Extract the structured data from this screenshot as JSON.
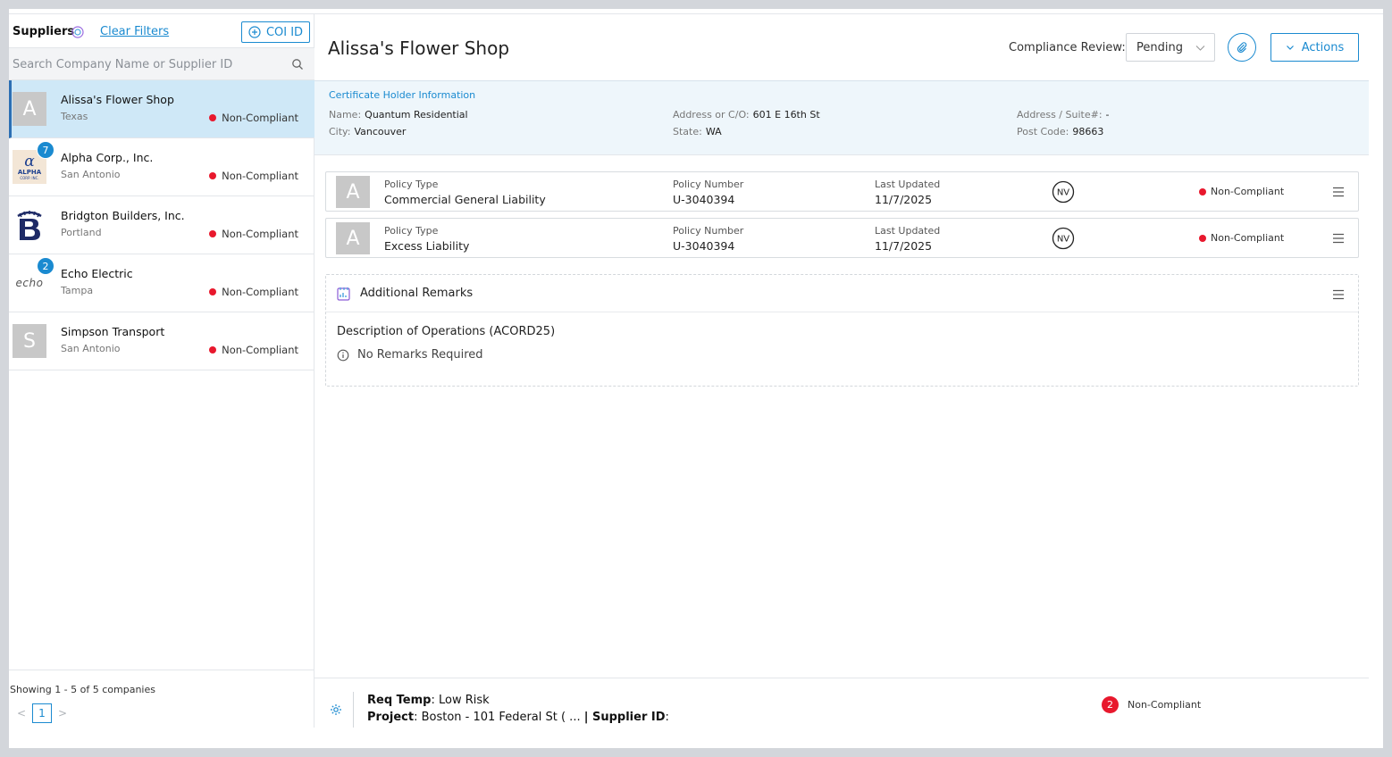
{
  "sidebar": {
    "title": "Suppliers",
    "clear_filters": "Clear Filters",
    "coi_button": "COI ID",
    "search_placeholder": "Search Company Name or Supplier ID",
    "items": [
      {
        "name": "Alissa's Flower Shop",
        "location": "Texas",
        "status": "Non-Compliant",
        "avatar": "A",
        "badge": ""
      },
      {
        "name": "Alpha Corp., Inc.",
        "location": "San Antonio",
        "status": "Non-Compliant",
        "avatar": "logo-alpha",
        "badge": "7",
        "logo_text": "ALPHA",
        "logo_sub": "CORP. INC."
      },
      {
        "name": "Bridgton Builders, Inc.",
        "location": "Portland",
        "status": "Non-Compliant",
        "avatar": "logo-bridgton",
        "badge": ""
      },
      {
        "name": "Echo Electric",
        "location": "Tampa",
        "status": "Non-Compliant",
        "avatar": "logo-echo",
        "badge": "2",
        "logo_text": "echo"
      },
      {
        "name": "Simpson Transport",
        "location": "San Antonio",
        "status": "Non-Compliant",
        "avatar": "S",
        "badge": ""
      }
    ],
    "showing": "Showing 1 - 5 of 5 companies",
    "page": "1"
  },
  "main": {
    "title": "Alissa's Flower Shop",
    "compliance_label": "Compliance Review:",
    "compliance_value": "Pending",
    "actions_label": "Actions",
    "certificate": {
      "title": "Certificate Holder Information",
      "name_label": "Name:",
      "name": "Quantum Residential",
      "city_label": "City:",
      "city": "Vancouver",
      "address_label": "Address or C/O:",
      "address": "601 E 16th St",
      "state_label": "State:",
      "state": "WA",
      "suite_label": "Address / Suite#:",
      "suite": "-",
      "post_label": "Post Code:",
      "post": "98663"
    },
    "policies": [
      {
        "avatar": "A",
        "type_label": "Policy Type",
        "type": "Commercial General Liability",
        "number_label": "Policy Number",
        "number": "U-3040394",
        "updated_label": "Last Updated",
        "updated": "11/7/2025",
        "insurer_mark": "NV",
        "status": "Non-Compliant"
      },
      {
        "avatar": "A",
        "type_label": "Policy Type",
        "type": "Excess Liability",
        "number_label": "Policy Number",
        "number": "U-3040394",
        "updated_label": "Last Updated",
        "updated": "11/7/2025",
        "insurer_mark": "NV",
        "status": "Non-Compliant"
      }
    ],
    "remarks": {
      "title": "Additional Remarks",
      "description_title": "Description of Operations (ACORD25)",
      "no_remarks": "No Remarks Required"
    },
    "footer": {
      "req_temp_label": "Req Temp",
      "req_temp_value": ": Low Risk",
      "project_label": "Project",
      "project_value": ": Boston - 101 Federal St ( ... ",
      "supplier_id_label": "| Supplier ID",
      "supplier_id_value": ":",
      "count": "2",
      "status": "Non-Compliant"
    }
  },
  "colors": {
    "accent": "#1a8ad0",
    "noncompliant": "#e8182d",
    "selected_bg": "#cfe8f7"
  }
}
